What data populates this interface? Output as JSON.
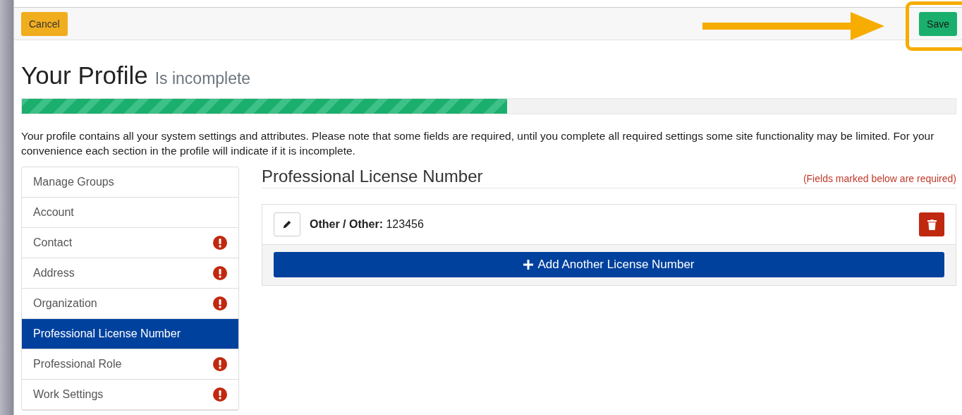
{
  "toolbar": {
    "cancel": "Cancel",
    "save": "Save"
  },
  "header": {
    "title": "Your Profile",
    "status": "Is incomplete"
  },
  "progress": {
    "level": 0.52
  },
  "intro": "Your profile contains all your system settings and attributes. Please note that some fields are required, until you complete all required settings some site functionality may be limited. For your convenience each section in the profile will indicate if it is incomplete.",
  "sidebar": {
    "items": [
      {
        "label": "Manage Groups",
        "selected": false,
        "incomplete": false
      },
      {
        "label": "Account",
        "selected": false,
        "incomplete": false
      },
      {
        "label": "Contact",
        "selected": false,
        "incomplete": true
      },
      {
        "label": "Address",
        "selected": false,
        "incomplete": true
      },
      {
        "label": "Organization",
        "selected": false,
        "incomplete": true
      },
      {
        "label": "Professional License Number",
        "selected": true,
        "incomplete": false
      },
      {
        "label": "Professional Role",
        "selected": false,
        "incomplete": true
      },
      {
        "label": "Work Settings",
        "selected": false,
        "incomplete": true
      }
    ]
  },
  "section": {
    "title": "Professional License Number",
    "required_note": "(Fields marked below are required)",
    "licenses": [
      {
        "label": "**Other / Other:** 123456"
      }
    ],
    "add_button": "Add Another License Number"
  }
}
